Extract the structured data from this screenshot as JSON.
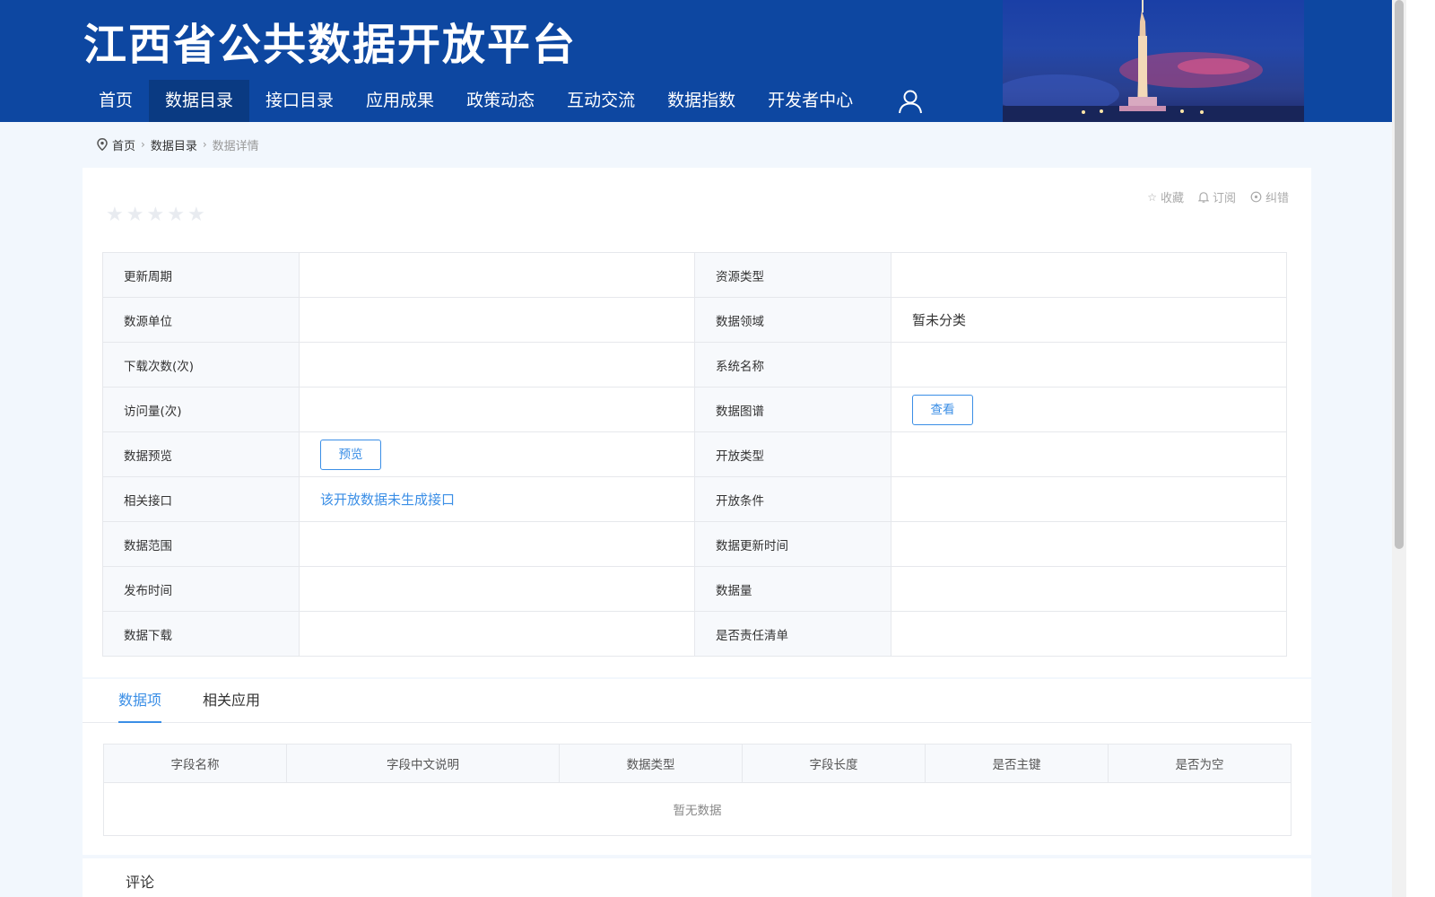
{
  "header": {
    "title": "江西省公共数据开放平台",
    "nav": [
      {
        "label": "首页",
        "active": false
      },
      {
        "label": "数据目录",
        "active": true
      },
      {
        "label": "接口目录",
        "active": false
      },
      {
        "label": "应用成果",
        "active": false
      },
      {
        "label": "政策动态",
        "active": false
      },
      {
        "label": "互动交流",
        "active": false
      },
      {
        "label": "数据指数",
        "active": false
      },
      {
        "label": "开发者中心",
        "active": false
      }
    ],
    "user_icon": "user-icon",
    "colors": {
      "background": "#0d47a1",
      "active_nav": "#0a3a82"
    }
  },
  "breadcrumb": {
    "icon": "location-pin-icon",
    "items": [
      "首页",
      "数据目录",
      "数据详情"
    ]
  },
  "detail": {
    "rating": {
      "value": 0,
      "max": 5
    },
    "actions": [
      {
        "icon": "star-outline-icon",
        "label": "收藏"
      },
      {
        "icon": "bell-icon",
        "label": "订阅"
      },
      {
        "icon": "report-icon",
        "label": "纠错"
      }
    ],
    "rows": [
      {
        "k1": "更新周期",
        "v1": "",
        "k2": "资源类型",
        "v2": ""
      },
      {
        "k1": "数源单位",
        "v1": "",
        "k2": "数据领域",
        "v2": "暂未分类"
      },
      {
        "k1": "下载次数(次)",
        "v1": "",
        "k2": "系统名称",
        "v2": ""
      },
      {
        "k1": "访问量(次)",
        "v1": "",
        "k2": "数据图谱",
        "v2_button": "查看"
      },
      {
        "k1": "数据预览",
        "v1_button": "预览",
        "k2": "开放类型",
        "v2": ""
      },
      {
        "k1": "相关接口",
        "v1_link": "该开放数据未生成接口",
        "k2": "开放条件",
        "v2": ""
      },
      {
        "k1": "数据范围",
        "v1": "",
        "k2": "数据更新时间",
        "v2": ""
      },
      {
        "k1": "发布时间",
        "v1": "",
        "k2": "数据量",
        "v2": ""
      },
      {
        "k1": "数据下载",
        "v1": "",
        "k2": "是否责任清单",
        "v2": ""
      }
    ],
    "accent_color": "#3a8ee6"
  },
  "tabs": {
    "items": [
      {
        "label": "数据项",
        "active": true
      },
      {
        "label": "相关应用",
        "active": false
      }
    ],
    "table": {
      "columns": [
        "字段名称",
        "字段中文说明",
        "数据类型",
        "字段长度",
        "是否主键",
        "是否为空"
      ],
      "empty_text": "暂无数据"
    }
  },
  "comments": {
    "title": "评论"
  }
}
